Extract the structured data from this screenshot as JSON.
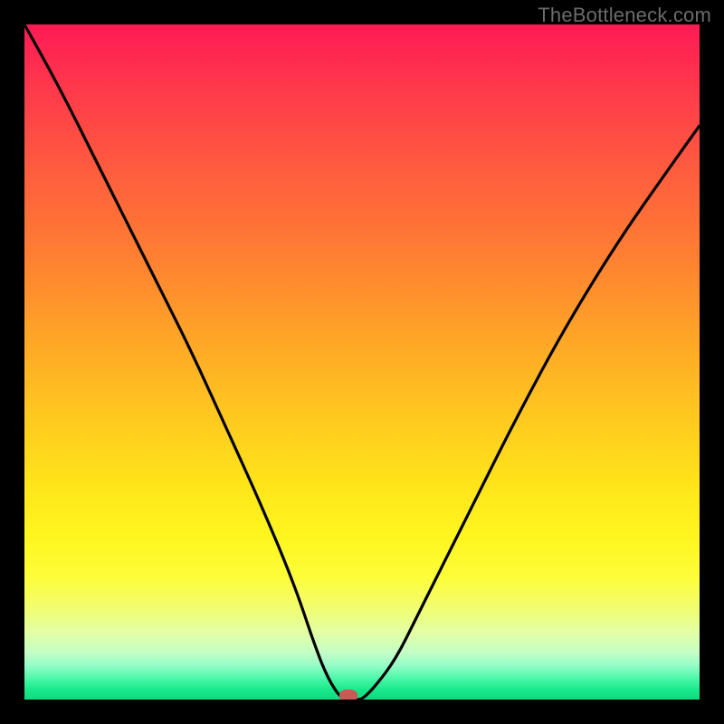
{
  "watermark": "TheBottleneck.com",
  "colors": {
    "frame": "#000000",
    "curve": "#000000",
    "marker": "#c65a54"
  },
  "chart_data": {
    "type": "line",
    "title": "",
    "xlabel": "",
    "ylabel": "",
    "xlim": [
      0,
      100
    ],
    "ylim": [
      0,
      100
    ],
    "grid": false,
    "legend": false,
    "series": [
      {
        "name": "bottleneck-curve",
        "x": [
          0,
          5,
          10,
          15,
          20,
          25,
          30,
          35,
          40,
          43,
          45,
          47,
          49,
          50,
          52,
          55,
          58,
          62,
          67,
          73,
          80,
          88,
          95,
          100
        ],
        "values": [
          100,
          91,
          81,
          71,
          61,
          51,
          40,
          29,
          17,
          8,
          3,
          0,
          0,
          0,
          2,
          6,
          12,
          20,
          30,
          42,
          55,
          68,
          78,
          85
        ]
      }
    ],
    "marker": {
      "x": 48,
      "y": 0
    },
    "background_gradient": {
      "orientation": "vertical",
      "stops": [
        {
          "pos": 0.0,
          "color": "#ff1a54"
        },
        {
          "pos": 0.22,
          "color": "#ff5d3e"
        },
        {
          "pos": 0.46,
          "color": "#ffa427"
        },
        {
          "pos": 0.68,
          "color": "#ffe41a"
        },
        {
          "pos": 0.86,
          "color": "#e2ffa3"
        },
        {
          "pos": 0.97,
          "color": "#48f7a7"
        },
        {
          "pos": 1.0,
          "color": "#0fd97f"
        }
      ]
    }
  }
}
